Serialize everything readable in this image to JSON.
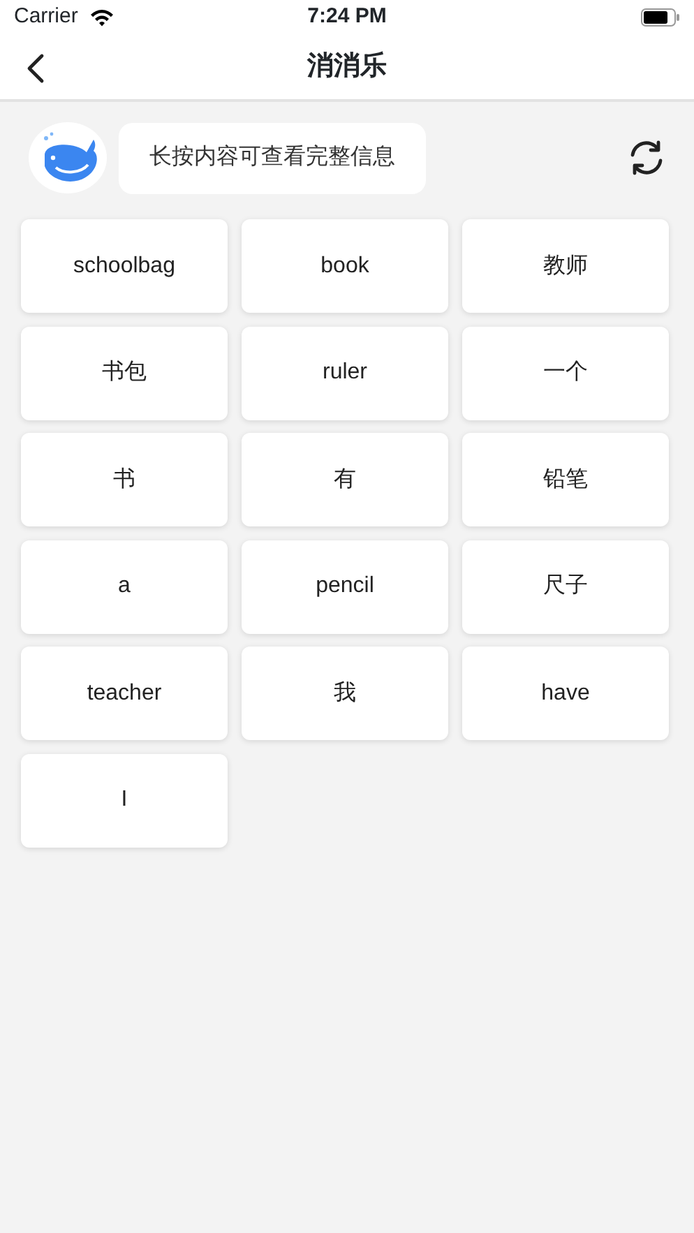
{
  "status_bar": {
    "carrier": "Carrier",
    "time": "7:24 PM"
  },
  "nav": {
    "title": "消消乐"
  },
  "hint": "长按内容可查看完整信息",
  "cards": [
    {
      "text": "schoolbag"
    },
    {
      "text": "book"
    },
    {
      "text": "教师"
    },
    {
      "text": "书包"
    },
    {
      "text": "ruler"
    },
    {
      "text": "一个"
    },
    {
      "text": "书"
    },
    {
      "text": "有"
    },
    {
      "text": "铅笔"
    },
    {
      "text": "a"
    },
    {
      "text": "pencil"
    },
    {
      "text": "尺子"
    },
    {
      "text": "teacher"
    },
    {
      "text": "我"
    },
    {
      "text": "have"
    },
    {
      "text": "I"
    }
  ]
}
